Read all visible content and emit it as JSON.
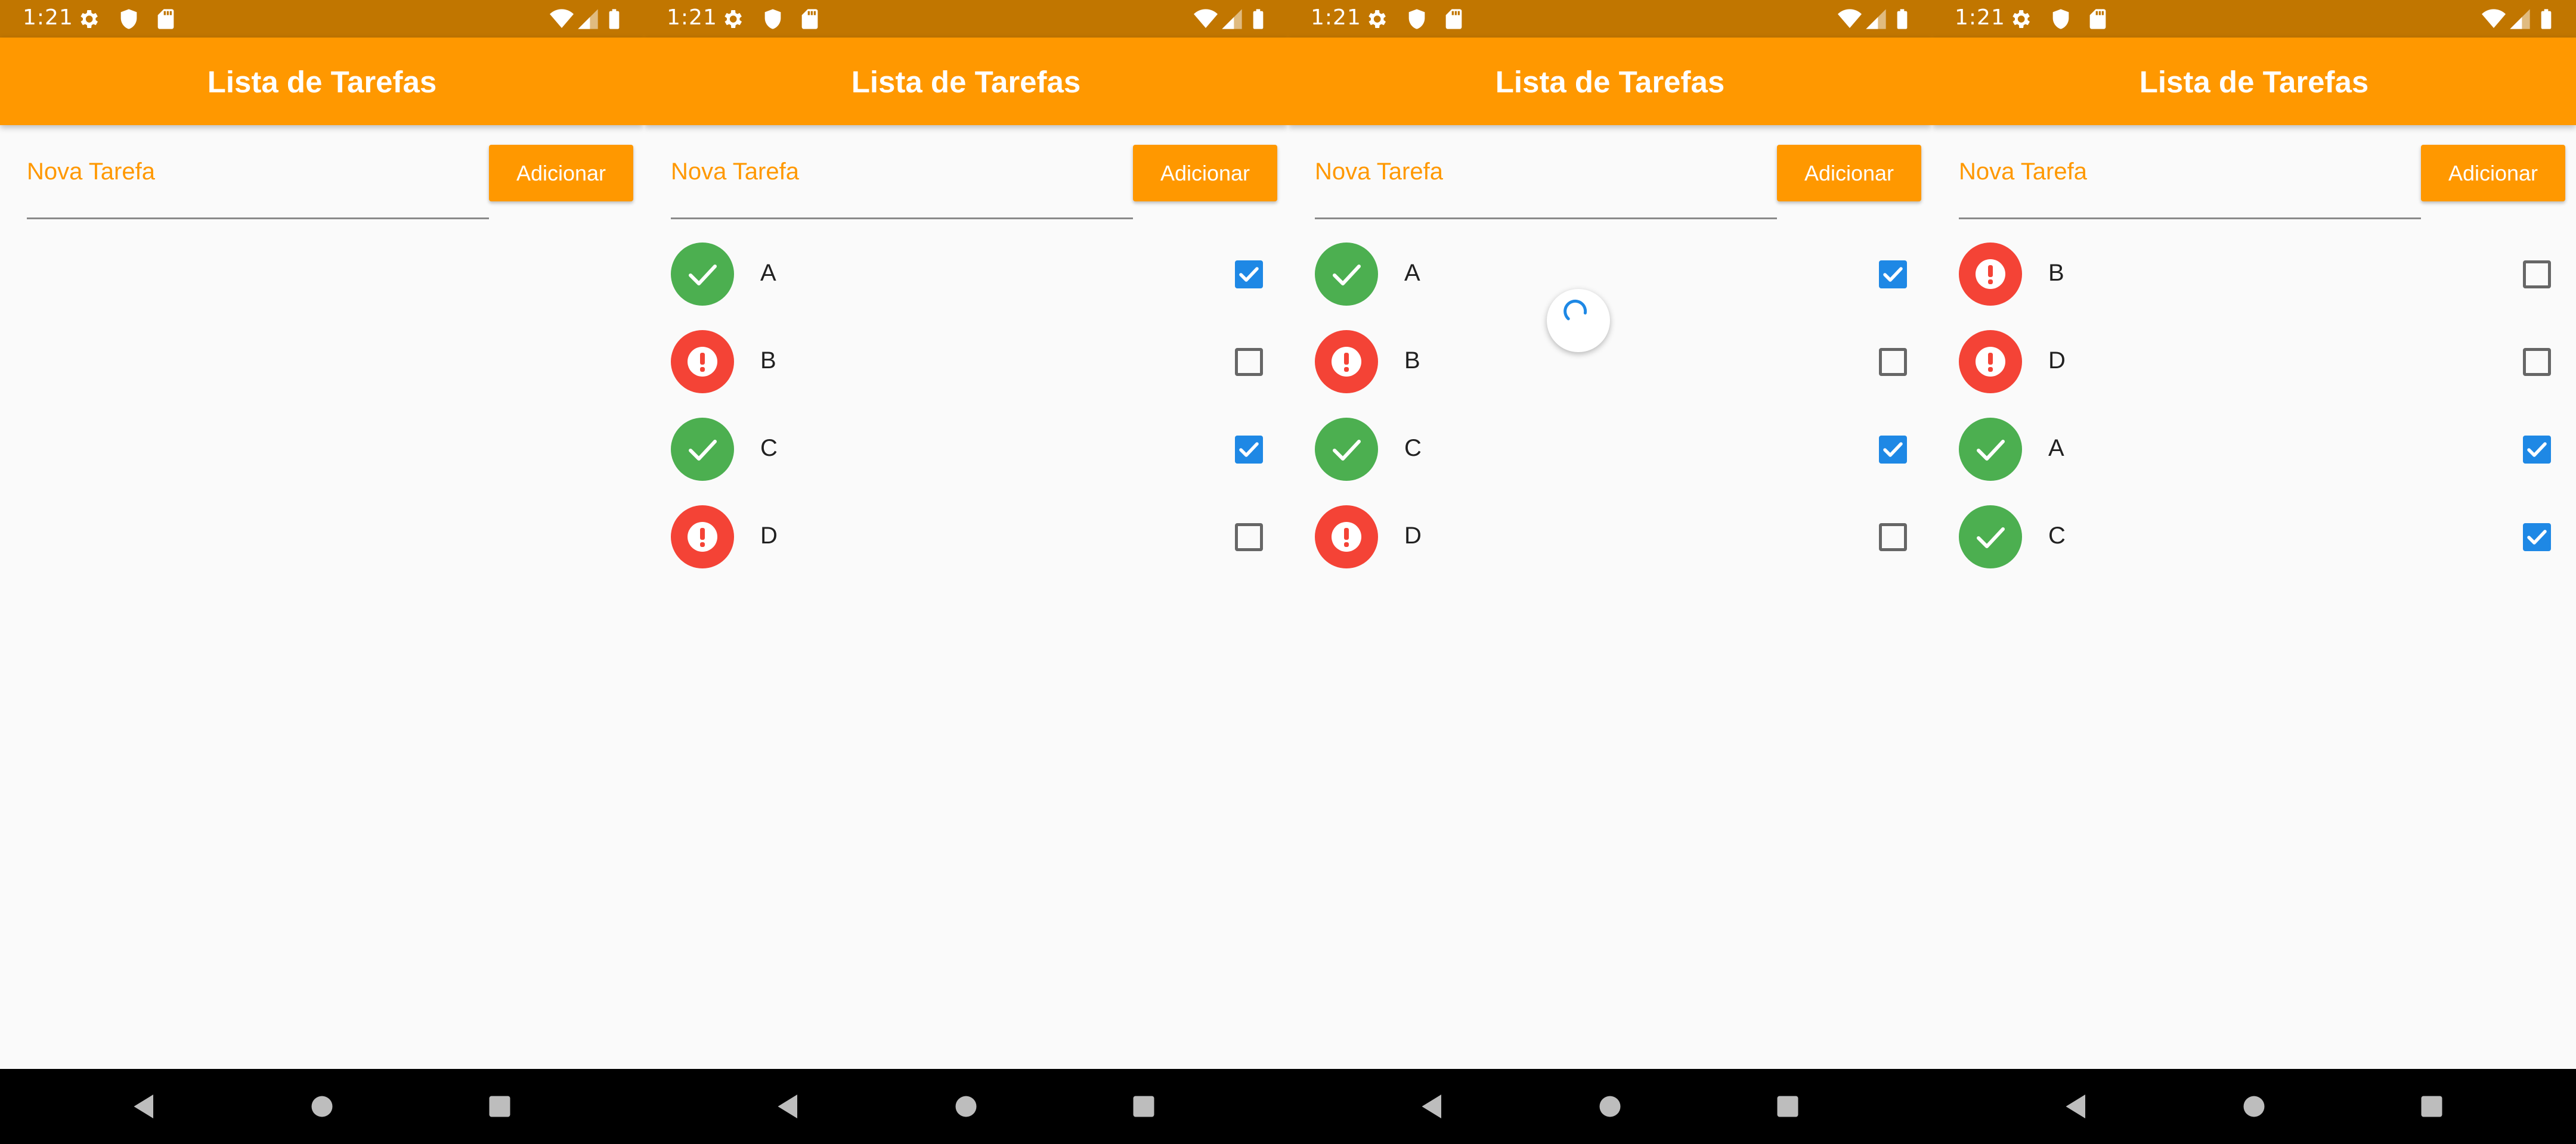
{
  "colors": {
    "accent": "#ff9800",
    "status_bar": "#c17600",
    "done": "#4caf50",
    "pending": "#f44336",
    "checkbox_checked": "#1e88e5"
  },
  "screens": [
    {
      "status_time": "1:21",
      "title": "Lista de Tarefas",
      "input_placeholder": "Nova Tarefa",
      "add_button": "Adicionar",
      "loading": false,
      "tasks": []
    },
    {
      "status_time": "1:21",
      "title": "Lista de Tarefas",
      "input_placeholder": "Nova Tarefa",
      "add_button": "Adicionar",
      "loading": false,
      "tasks": [
        {
          "label": "A",
          "done": true
        },
        {
          "label": "B",
          "done": false
        },
        {
          "label": "C",
          "done": true
        },
        {
          "label": "D",
          "done": false
        }
      ]
    },
    {
      "status_time": "1:21",
      "title": "Lista de Tarefas",
      "input_placeholder": "Nova Tarefa",
      "add_button": "Adicionar",
      "loading": true,
      "tasks": [
        {
          "label": "A",
          "done": true
        },
        {
          "label": "B",
          "done": false
        },
        {
          "label": "C",
          "done": true
        },
        {
          "label": "D",
          "done": false
        }
      ]
    },
    {
      "status_time": "1:21",
      "title": "Lista de Tarefas",
      "input_placeholder": "Nova Tarefa",
      "add_button": "Adicionar",
      "loading": false,
      "tasks": [
        {
          "label": "B",
          "done": false
        },
        {
          "label": "D",
          "done": false
        },
        {
          "label": "A",
          "done": true
        },
        {
          "label": "C",
          "done": true
        }
      ]
    }
  ]
}
